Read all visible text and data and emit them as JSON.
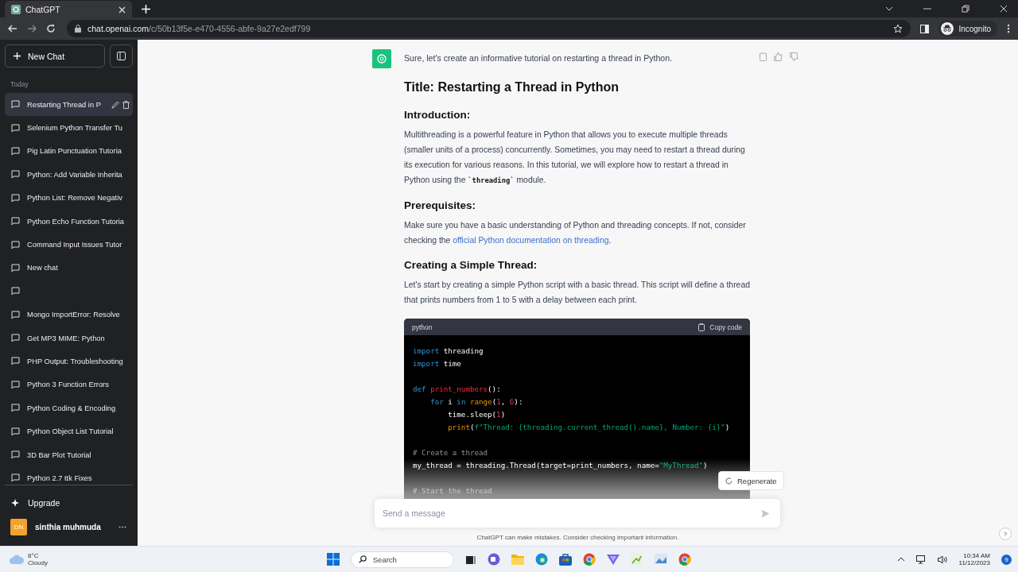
{
  "browser": {
    "tab_title": "ChatGPT",
    "url_host": "chat.openai.com",
    "url_path": "/c/50b13f5e-e470-4556-abfe-9a27e2edf799",
    "profile": "Incognito"
  },
  "sidebar": {
    "new_chat": "New Chat",
    "section": "Today",
    "items": [
      {
        "title": "Restarting Thread in P",
        "selected": true
      },
      {
        "title": "Selenium Python Transfer Tu",
        "selected": false
      },
      {
        "title": "Pig Latin Punctuation Tutoria",
        "selected": false
      },
      {
        "title": "Python: Add Variable Inherita",
        "selected": false
      },
      {
        "title": "Python List: Remove Negativ",
        "selected": false
      },
      {
        "title": "Python Echo Function Tutoria",
        "selected": false
      },
      {
        "title": "Command Input Issues Tutor",
        "selected": false
      },
      {
        "title": "New chat",
        "selected": false
      },
      {
        "selected": false
      },
      {
        "title": "Mongo ImportError: Resolve",
        "selected": false
      },
      {
        "title": "Get MP3 MIME: Python",
        "selected": false
      },
      {
        "title": "PHP Output: Troubleshooting",
        "selected": false
      },
      {
        "title": "Python 3 Function Errors",
        "selected": false
      },
      {
        "title": "Python Coding & Encoding",
        "selected": false
      },
      {
        "title": "Python Object List Tutorial",
        "selected": false
      },
      {
        "title": "3D Bar Plot Tutorial",
        "selected": false
      },
      {
        "title": "Python 2.7 ttk Fixes",
        "selected": false
      }
    ],
    "upgrade": "Upgrade",
    "user": {
      "initials": "DN",
      "name": "sinthia muhmuda"
    }
  },
  "message": {
    "intro": "Sure, let's create an informative tutorial on restarting a thread in Python.",
    "blocks": [
      {
        "kind": "heading1",
        "text": "Title: Restarting a Thread in Python"
      },
      {
        "kind": "heading2",
        "text": "Introduction:"
      },
      {
        "kind": "paragraph",
        "parts": [
          {
            "kind": "text",
            "text": "Multithreading is a powerful feature in Python that allows you to execute multiple threads (smaller units of a process) concurrently. Sometimes, you may need to restart a thread during its execution for various reasons. In this tutorial, we will explore how to restart a thread in Python using the "
          },
          {
            "kind": "code",
            "text": "`threading`"
          },
          {
            "kind": "text",
            "text": " module."
          }
        ]
      },
      {
        "kind": "heading2",
        "text": "Prerequisites:"
      },
      {
        "kind": "paragraph",
        "parts": [
          {
            "kind": "text",
            "text": "Make sure you have a basic understanding of Python and threading concepts. If not, consider checking the "
          },
          {
            "kind": "link",
            "text": "official Python documentation on threading"
          },
          {
            "kind": "text",
            "text": "."
          }
        ]
      },
      {
        "kind": "heading2",
        "text": "Creating a Simple Thread:"
      },
      {
        "kind": "paragraph",
        "parts": [
          {
            "kind": "text",
            "text": "Let's start by creating a simple Python script with a basic thread. This script will define a thread that prints numbers from 1 to 5 with a delay between each print."
          }
        ]
      },
      {
        "kind": "code",
        "language": "python",
        "copy": "Copy code",
        "lines": [
          {
            "kind": "code",
            "tokens": [
              {
                "kind": "kw",
                "text": "import"
              },
              {
                "kind": "plain",
                "text": " threading"
              }
            ]
          },
          {
            "kind": "code",
            "tokens": [
              {
                "kind": "kw",
                "text": "import"
              },
              {
                "kind": "plain",
                "text": " time"
              }
            ]
          },
          {
            "kind": "blank"
          },
          {
            "kind": "code",
            "tokens": [
              {
                "kind": "kw",
                "text": "def "
              },
              {
                "kind": "fn",
                "text": "print_numbers"
              },
              {
                "kind": "plain",
                "text": "():"
              }
            ]
          },
          {
            "kind": "code",
            "tokens": [
              {
                "kind": "kw",
                "text": "    for"
              },
              {
                "kind": "plain",
                "text": " i "
              },
              {
                "kind": "kw",
                "text": "in "
              },
              {
                "kind": "builtin",
                "text": "range"
              },
              {
                "kind": "plain",
                "text": "("
              },
              {
                "kind": "num",
                "text": "1"
              },
              {
                "kind": "plain",
                "text": ", "
              },
              {
                "kind": "num",
                "text": "6"
              },
              {
                "kind": "plain",
                "text": "):"
              }
            ]
          },
          {
            "kind": "code",
            "tokens": [
              {
                "kind": "plain",
                "text": "        time.sleep("
              },
              {
                "kind": "num",
                "text": "1"
              },
              {
                "kind": "plain",
                "text": ")"
              }
            ]
          },
          {
            "kind": "code",
            "tokens": [
              {
                "kind": "builtin",
                "text": "        print"
              },
              {
                "kind": "plain",
                "text": "("
              },
              {
                "kind": "str",
                "text": "f\"Thread: {threading.current_thread().name}, Number: {i}\""
              },
              {
                "kind": "plain",
                "text": ")"
              }
            ]
          },
          {
            "kind": "blank"
          },
          {
            "kind": "code",
            "tokens": [
              {
                "kind": "comment",
                "text": "# Create a thread"
              }
            ]
          },
          {
            "kind": "code",
            "tokens": [
              {
                "kind": "plain",
                "text": "my_thread = threading.Thread(target=print_numbers, name="
              },
              {
                "kind": "str",
                "text": "\"MyThread\""
              },
              {
                "kind": "plain",
                "text": ")"
              }
            ]
          },
          {
            "kind": "blank"
          },
          {
            "kind": "code",
            "tokens": [
              {
                "kind": "comment",
                "text": "# Start the thread"
              }
            ]
          }
        ]
      }
    ]
  },
  "regenerate": "Regenerate",
  "composer": {
    "placeholder": "Send a message"
  },
  "disclaimer": "ChatGPT can make mistakes. Consider checking important information.",
  "help": "?",
  "taskbar": {
    "weather_temp": "8°C",
    "weather_text": "Cloudy",
    "search": "Search",
    "time": "10:34 AM",
    "date": "11/12/2023",
    "notifications": "9"
  }
}
